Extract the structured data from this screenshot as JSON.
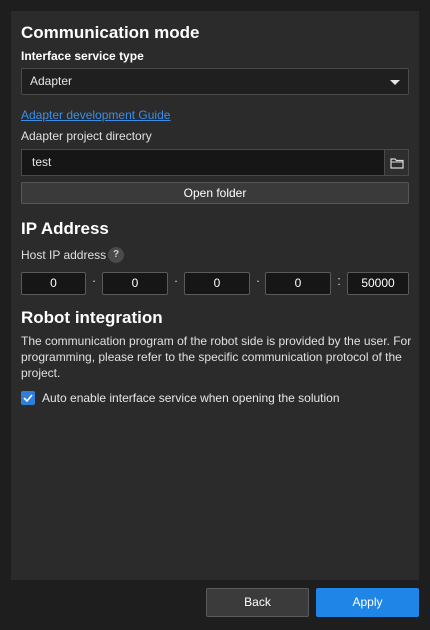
{
  "communication": {
    "title": "Communication mode",
    "interface_type_label": "Interface service type",
    "interface_type_value": "Adapter",
    "guide_link": "Adapter development Guide",
    "project_dir_label": "Adapter project directory",
    "project_dir_value": "test",
    "open_folder_label": "Open folder"
  },
  "ip": {
    "title": "IP Address",
    "host_label": "Host IP address",
    "help_glyph": "?",
    "octets": [
      "0",
      "0",
      "0",
      "0"
    ],
    "port": "50000",
    "octet_separator": "·",
    "port_separator": ":"
  },
  "robot": {
    "title": "Robot integration",
    "description": "The communication program of the robot side is provided by the user. For programming, please refer to the specific communication protocol of the project.",
    "auto_enable_label": "Auto enable interface service when opening the solution",
    "auto_enable_checked": true
  },
  "footer": {
    "back_label": "Back",
    "apply_label": "Apply"
  },
  "colors": {
    "accent": "#1f86e8",
    "link": "#3b8ee8",
    "panel": "#2b2b2b",
    "background": "#1e1e1e"
  },
  "icons": {
    "folder": "folder-icon",
    "dropdown": "chevron-down-icon",
    "check": "check-icon",
    "help": "help-icon"
  }
}
